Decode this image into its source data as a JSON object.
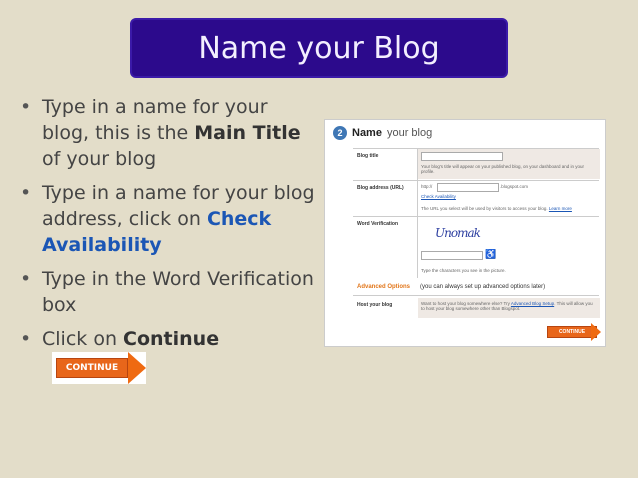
{
  "title": "Name your Blog",
  "bullets": [
    {
      "pre": "Type in a name for your blog, this is the ",
      "bold": "Main Title",
      "post": " of your blog"
    },
    {
      "pre": "Type in a name for your blog address, click on ",
      "link": "Check Availability"
    },
    {
      "pre": "Type in the Word Verification box"
    },
    {
      "pre": "Click on ",
      "bold": "Continue"
    }
  ],
  "continue_label": "CONTINUE",
  "panel": {
    "step": "2",
    "heading_bold": "Name",
    "heading_rest": "your blog",
    "blog_title_label": "Blog title",
    "blog_title_help": "Your blog's title will appear on your published blog, on your dashboard and in your profile.",
    "address_label": "Blog address (URL)",
    "address_prefix": "http://",
    "address_suffix": ".blogspot.com",
    "check_link": "Check Availability",
    "address_help": "The URL you select will be used by visitors to access your blog.",
    "learn_more": "Learn more",
    "word_verification_label": "Word Verification",
    "captcha_text": "Unomak",
    "captcha_help": "Type the characters you see in the picture.",
    "advanced_label": "Advanced Options",
    "advanced_note": "(you can always set up advanced options later)",
    "host_label": "Host your blog",
    "host_text_pre": "Want to host your blog somewhere else? Try ",
    "host_link": "Advanced Blog Setup",
    "host_text_post": ". This will allow you to host your blog somewhere other than Blogspot.",
    "continue_label": "CONTINUE"
  },
  "colors": {
    "title_bg": "#2c0a8c",
    "link": "#1b56b5",
    "continue": "#e8661a",
    "background": "#e3ddc9"
  }
}
